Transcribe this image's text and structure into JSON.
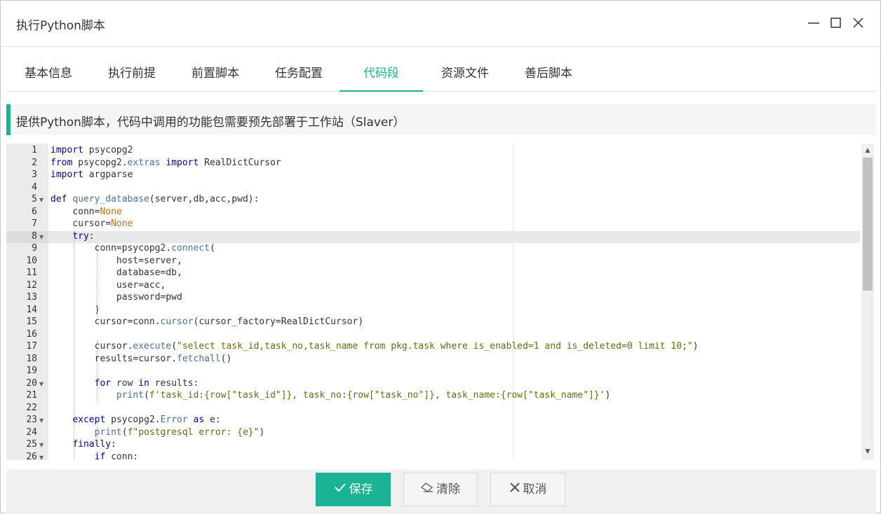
{
  "window": {
    "title": "执行Python脚本"
  },
  "tabs": [
    {
      "label": "基本信息"
    },
    {
      "label": "执行前提"
    },
    {
      "label": "前置脚本"
    },
    {
      "label": "任务配置"
    },
    {
      "label": "代码段",
      "active": true
    },
    {
      "label": "资源文件"
    },
    {
      "label": "善后脚本"
    }
  ],
  "notice": {
    "text": "提供Python脚本，代码中调用的功能包需要预先部署于工作站（Slaver）"
  },
  "editor": {
    "current_line": 8,
    "line_numbers": [
      "1",
      "2",
      "3",
      "4",
      "5",
      "6",
      "7",
      "8",
      "9",
      "10",
      "11",
      "12",
      "13",
      "14",
      "15",
      "16",
      "17",
      "18",
      "19",
      "20",
      "21",
      "22",
      "23",
      "24",
      "25",
      "26"
    ],
    "fold_markers": [
      5,
      8,
      20,
      23,
      25,
      26
    ],
    "lines": [
      "import psycopg2",
      "from psycopg2.extras import RealDictCursor",
      "import argparse",
      "",
      "def query_database(server,db,acc,pwd):",
      "    conn=None",
      "    cursor=None",
      "    try:",
      "        conn=psycopg2.connect(",
      "            host=server,",
      "            database=db,",
      "            user=acc,",
      "            password=pwd",
      "        )",
      "        cursor=conn.cursor(cursor_factory=RealDictCursor)",
      "",
      "        cursor.execute(\"select task_id,task_no,task_name from pkg.task where is_enabled=1 and is_deleted=0 limit 10;\")",
      "        results=cursor.fetchall()",
      "",
      "        for row in results:",
      "            print(f'task_id:{row[\"task_id\"]}, task_no:{row[\"task_no\"]}, task_name:{row[\"task_name\"]}')",
      "",
      "    except psycopg2.Error as e:",
      "        print(f\"postgresql error: {e}\")",
      "    finally:",
      "        if conn:"
    ]
  },
  "footer": {
    "save_label": "保存",
    "clear_label": "清除",
    "cancel_label": "取消"
  },
  "colors": {
    "accent": "#1ab394"
  }
}
